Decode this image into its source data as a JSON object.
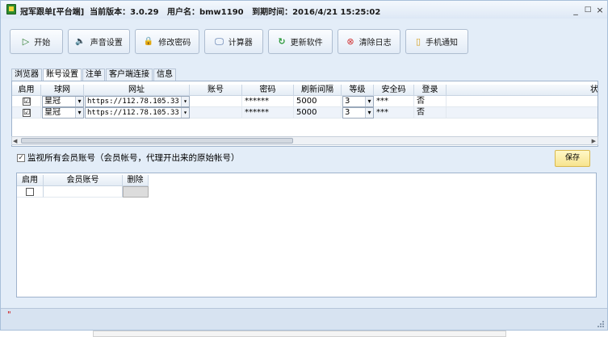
{
  "window": {
    "title": "冠军跟单[平台端]  当前版本：3.0.29   用户名：bmw1190   到期时间：2016/4/21 15:25:02",
    "minimize": "_",
    "maximize": "□",
    "close": "×"
  },
  "toolbar": [
    {
      "label": "开始",
      "icon": "play-icon",
      "glyph": "▷",
      "color": "#2a7a2a"
    },
    {
      "label": "声音设置",
      "icon": "speaker-icon",
      "glyph": "🔈",
      "color": "#4466aa"
    },
    {
      "label": "修改密码",
      "icon": "lock-icon",
      "glyph": "🔒",
      "color": "#d4a020"
    },
    {
      "label": "计算器",
      "icon": "monitor-icon",
      "glyph": "🖵",
      "color": "#3a5f9a"
    },
    {
      "label": "更新软件",
      "icon": "refresh-icon",
      "glyph": "↻",
      "color": "#2e9a3c"
    },
    {
      "label": "清除日志",
      "icon": "clear-icon",
      "glyph": "⊗",
      "color": "#d03030"
    },
    {
      "label": "手机通知",
      "icon": "phone-icon",
      "glyph": "▯",
      "color": "#d4a020"
    }
  ],
  "tabs": [
    "浏览器",
    "账号设置",
    "注单",
    "客户端连接",
    "信息"
  ],
  "active_tab": "账号设置",
  "accounts_table": {
    "headers": [
      "启用",
      "球网",
      "网址",
      "账号",
      "密码",
      "刷新间隔",
      "等级",
      "安全码",
      "登录",
      "状"
    ],
    "rows": [
      {
        "enabled": "☑",
        "site": "皇冠",
        "url": "https://112.78.105.33",
        "account": "",
        "password": "******",
        "interval": "5000",
        "level": "3",
        "security": "***",
        "login": "否"
      },
      {
        "enabled": "☑",
        "site": "皇冠",
        "url": "https://112.78.105.33",
        "account": "",
        "password": "******",
        "interval": "5000",
        "level": "3",
        "security": "***",
        "login": "否"
      }
    ]
  },
  "monitor": {
    "checked": "✓",
    "label": "监视所有会员账号（会员帐号，代理开出来的原始帐号）",
    "save_label": "保存"
  },
  "members_table": {
    "headers": [
      "启用",
      "会员账号",
      "删除"
    ]
  },
  "status": {
    "mark": "\""
  }
}
